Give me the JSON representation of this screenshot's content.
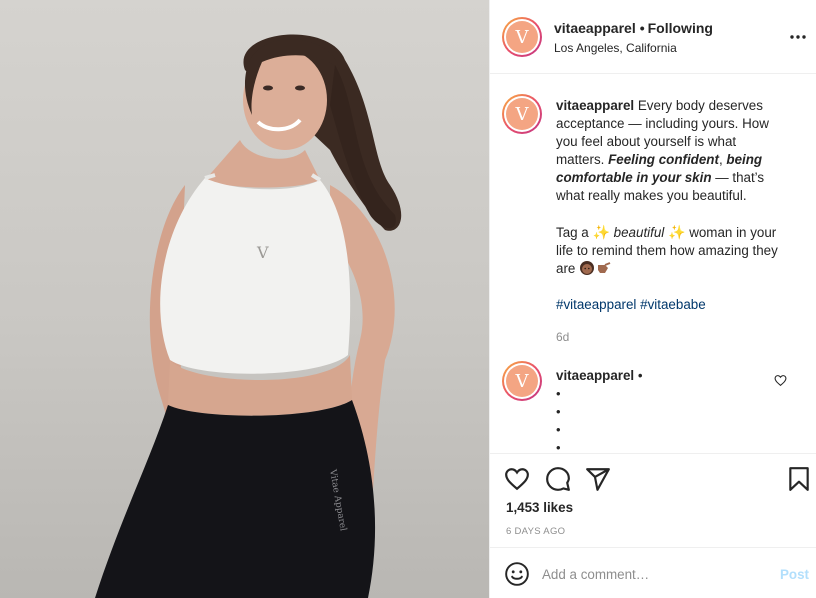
{
  "post": {
    "username": "vitaeapparel",
    "avatar_letter": "V",
    "brand_color": "#f4a583",
    "following_label": "Following",
    "location": "Los Angeles, California",
    "more_icon": "more-horizontal-icon"
  },
  "photo": {
    "logo_mark": "V",
    "leggings_text": "Vitae Apparel",
    "colors": {
      "top": "#f2f2f0",
      "leggings": "#141418",
      "hair": "#3b2a22",
      "skin": "#d8a993"
    }
  },
  "caption": {
    "username": "vitaeapparel",
    "text_1": " Every body deserves acceptance — including yours. How you feel about yourself is what matters. ",
    "bold_1": "Feeling confident",
    "text_2": ", ",
    "bold_2": "being comfortable in your skin",
    "text_3": " — that’s what really makes you beautiful.",
    "tag_prefix": "Tag a ",
    "sparkle": "✨",
    "beautiful": "beautiful",
    "tag_suffix": " woman in your life to remind them how amazing they are ",
    "hashtag_1": "#vitaeapparel",
    "hashtag_2": "#vitaebabe",
    "age": "6d"
  },
  "comment": {
    "username": "vitaeapparel",
    "dot": "•",
    "bullets": [
      "•",
      "•",
      "•",
      "•"
    ]
  },
  "actions": {
    "icons": [
      "heart-icon",
      "comment-icon",
      "share-icon",
      "bookmark-icon"
    ],
    "likes": "1,453 likes",
    "date": "6 DAYS AGO"
  },
  "add_comment": {
    "placeholder": "Add a comment…",
    "post_label": "Post",
    "post_color": "#b2dffc"
  }
}
